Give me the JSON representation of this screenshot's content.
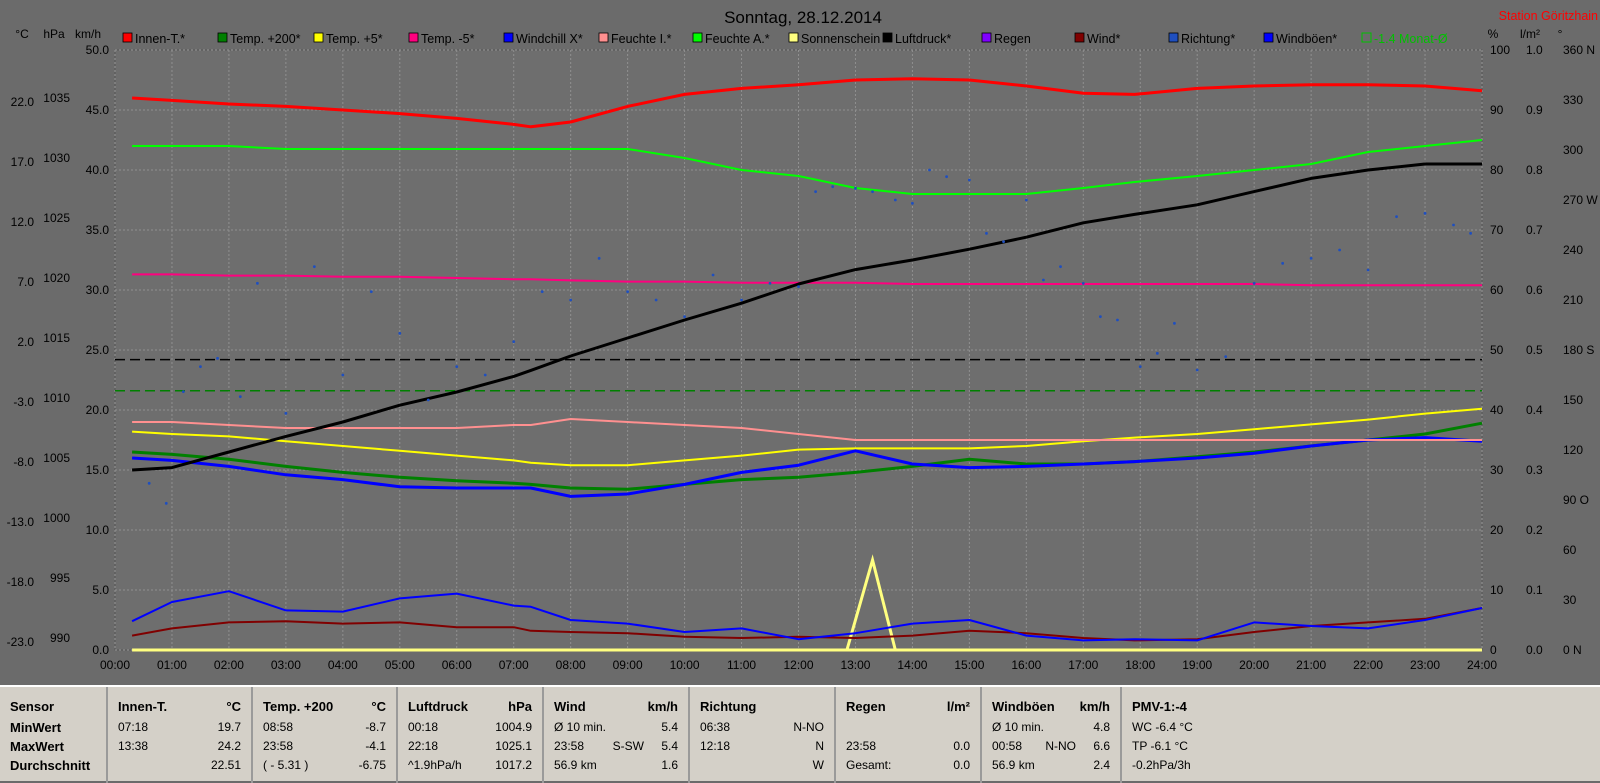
{
  "chart_data": {
    "type": "line",
    "title": "Sonntag, 28.12.2014",
    "station": "Station Göritzhain",
    "axis_units": {
      "left1": "°C",
      "left2": "hPa",
      "left3": "km/h",
      "right1": "%",
      "right2": "l/m²",
      "right3": "°"
    },
    "ylim_temp": [
      -23,
      27
    ],
    "ylim_hpa": [
      990,
      1040
    ],
    "ylim_kmh": [
      0,
      50
    ],
    "ylim_pct": [
      0,
      100
    ],
    "ylim_rain": [
      0,
      1
    ],
    "ylim_dir": [
      0,
      360
    ],
    "ticks_temp": [
      "-23.0",
      "-18.0",
      "-13.0",
      "-8.0",
      "-3.0",
      "2.0",
      "7.0",
      "12.0",
      "17.0",
      "22.0"
    ],
    "ticks_hpa": [
      "990",
      "995",
      "1000",
      "1005",
      "1010",
      "1015",
      "1020",
      "1025",
      "1030",
      "1035"
    ],
    "ticks_kmh": [
      "0.0",
      "5.0",
      "10.0",
      "15.0",
      "20.0",
      "25.0",
      "30.0",
      "35.0",
      "40.0",
      "45.0",
      "50.0"
    ],
    "ticks_pct": [
      "0",
      "10",
      "20",
      "30",
      "40",
      "50",
      "60",
      "70",
      "80",
      "90",
      "100"
    ],
    "ticks_rain": [
      "0.0",
      "0.1",
      "0.2",
      "0.3",
      "0.4",
      "0.5",
      "0.6",
      "0.7",
      "0.8",
      "0.9",
      "1.0"
    ],
    "ticks_dir": [
      "0 N",
      "30",
      "60",
      "90 O",
      "120",
      "150",
      "180 S",
      "210",
      "240",
      "270 W",
      "300",
      "330",
      "360 N"
    ],
    "x_labels": [
      "00:00",
      "01:00",
      "02:00",
      "03:00",
      "04:00",
      "05:00",
      "06:00",
      "07:00",
      "08:00",
      "09:00",
      "10:00",
      "11:00",
      "12:00",
      "13:00",
      "14:00",
      "15:00",
      "16:00",
      "17:00",
      "18:00",
      "19:00",
      "20:00",
      "21:00",
      "22:00",
      "23:00",
      "24:00"
    ],
    "x": [
      0.3,
      1,
      2,
      3,
      4,
      5,
      6,
      7,
      7.3,
      8,
      9,
      10,
      11,
      12,
      13,
      14,
      15,
      16,
      17,
      17.9,
      19,
      20,
      21,
      22,
      23,
      24
    ],
    "legend_note": "-1.4 Monat-Ø",
    "series": [
      {
        "name": "Innen-T.*",
        "color": "#ff0000",
        "axis": "temp",
        "width": 3,
        "values": [
          23.0,
          22.8,
          22.5,
          22.3,
          22.0,
          21.7,
          21.3,
          20.8,
          20.6,
          21.0,
          22.3,
          23.3,
          23.8,
          24.1,
          24.5,
          24.6,
          24.5,
          24.0,
          23.4,
          23.3,
          23.8,
          24.0,
          24.1,
          24.1,
          24.0,
          23.6
        ]
      },
      {
        "name": "Temp. +200*",
        "color": "#008000",
        "axis": "temp",
        "width": 3,
        "values": [
          -6.5,
          -6.7,
          -7.1,
          -7.7,
          -8.2,
          -8.6,
          -8.9,
          -9.1,
          -9.2,
          -9.5,
          -9.6,
          -9.2,
          -8.8,
          -8.6,
          -8.2,
          -7.7,
          -7.1,
          -7.5,
          -7.5,
          -7.3,
          -6.9,
          -6.5,
          -6.0,
          -5.5,
          -5.0,
          -4.1
        ]
      },
      {
        "name": "Temp. +5*",
        "color": "#ffff00",
        "axis": "temp",
        "width": 2,
        "values": [
          -4.8,
          -5.0,
          -5.2,
          -5.6,
          -6.0,
          -6.4,
          -6.8,
          -7.2,
          -7.4,
          -7.6,
          -7.6,
          -7.2,
          -6.8,
          -6.3,
          -6.2,
          -6.2,
          -6.2,
          -6.0,
          -5.6,
          -5.3,
          -5.0,
          -4.6,
          -4.2,
          -3.8,
          -3.3,
          -2.9
        ]
      },
      {
        "name": "Temp. -5*",
        "color": "#ff007f",
        "axis": "temp",
        "width": 2,
        "values": [
          8.3,
          8.3,
          8.2,
          8.2,
          8.1,
          8.1,
          8.0,
          7.9,
          7.9,
          7.8,
          7.7,
          7.7,
          7.6,
          7.6,
          7.6,
          7.5,
          7.5,
          7.5,
          7.5,
          7.5,
          7.5,
          7.5,
          7.4,
          7.4,
          7.4,
          7.4
        ]
      },
      {
        "name": "Windchill X*",
        "color": "#0000ff",
        "axis": "temp",
        "width": 3,
        "values": [
          -7.0,
          -7.2,
          -7.7,
          -8.4,
          -8.8,
          -9.4,
          -9.5,
          -9.5,
          -9.5,
          -10.2,
          -10.0,
          -9.2,
          -8.2,
          -7.6,
          -6.4,
          -7.5,
          -7.8,
          -7.7,
          -7.5,
          -7.3,
          -7.0,
          -6.6,
          -6.0,
          -5.5,
          -5.3,
          -5.6
        ]
      },
      {
        "name": "Feuchte I.*",
        "color": "#ff9090",
        "axis": "pct",
        "width": 2,
        "values": [
          38,
          38,
          37.5,
          37,
          37,
          37,
          37,
          37.5,
          37.5,
          38.5,
          38,
          37.5,
          37,
          36,
          35,
          35,
          35,
          35,
          35,
          35,
          35,
          35,
          35,
          35,
          35,
          35
        ]
      },
      {
        "name": "Feuchte A.*",
        "color": "#00ff00",
        "axis": "pct",
        "width": 2,
        "values": [
          84,
          84,
          84,
          83.5,
          83.5,
          83.5,
          83.5,
          83.5,
          83.5,
          83.5,
          83.5,
          82,
          80,
          79,
          77,
          76,
          76,
          76,
          77,
          78,
          79,
          80,
          81,
          83,
          84,
          85
        ]
      },
      {
        "name": "Sonnenschein",
        "color": "#ffff80",
        "axis": "pct",
        "width": 3,
        "values": [
          0,
          0,
          0,
          0,
          0,
          0,
          0,
          0,
          0,
          0,
          0,
          0,
          0,
          0,
          0,
          0,
          0,
          0,
          0,
          0,
          0,
          0,
          0,
          0,
          0,
          0
        ],
        "spike": {
          "x": [
            12.85,
            13.3,
            13.7
          ],
          "values": [
            0,
            15,
            0
          ]
        }
      },
      {
        "name": "Luftdruck*",
        "color": "#000000",
        "axis": "hpa",
        "width": 3,
        "values": [
          1005.0,
          1005.2,
          1006.5,
          1007.8,
          1009.0,
          1010.4,
          1011.5,
          1012.8,
          1013.3,
          1014.5,
          1016.0,
          1017.5,
          1018.9,
          1020.5,
          1021.7,
          1022.5,
          1023.4,
          1024.4,
          1025.6,
          1026.3,
          1027.1,
          1028.2,
          1029.3,
          1030.0,
          1030.5,
          1030.5
        ]
      },
      {
        "name": "Regen",
        "color": "#8000ff",
        "axis": "rain",
        "width": 2,
        "values": []
      },
      {
        "name": "Wind*",
        "color": "#800000",
        "axis": "kmh",
        "width": 2,
        "values": [
          1.2,
          1.8,
          2.3,
          2.4,
          2.2,
          2.3,
          1.9,
          1.9,
          1.6,
          1.5,
          1.4,
          1.1,
          1.0,
          1.1,
          1.0,
          1.2,
          1.6,
          1.4,
          1.0,
          0.8,
          0.9,
          1.5,
          2.0,
          2.3,
          2.6,
          3.5
        ]
      },
      {
        "name": "Richtung*",
        "color": "#1f4fbf",
        "axis": "dir",
        "width": 0,
        "dots": {
          "x": [
            0.6,
            0.9,
            1.2,
            1.5,
            1.8,
            2.2,
            2.5,
            3.0,
            3.5,
            4.0,
            4.5,
            5.0,
            5.5,
            6.0,
            6.5,
            7.0,
            7.5,
            8.0,
            8.5,
            9.0,
            9.5,
            10.0,
            10.5,
            11.0,
            11.5,
            12.0,
            12.3,
            12.6,
            13.0,
            13.3,
            13.7,
            14.0,
            14.3,
            14.6,
            15.0,
            15.3,
            15.6,
            16.0,
            16.3,
            16.6,
            17.0,
            17.3,
            17.6,
            18.0,
            18.3,
            18.6,
            19.0,
            19.5,
            20.0,
            20.5,
            21.0,
            21.5,
            22.0,
            22.5,
            23.0,
            23.5,
            23.8
          ],
          "values": [
            100,
            88,
            155,
            170,
            175,
            152,
            220,
            142,
            230,
            165,
            215,
            190,
            150,
            170,
            165,
            185,
            215,
            210,
            235,
            215,
            210,
            200,
            225,
            210,
            220,
            218,
            275,
            278,
            277,
            275,
            270,
            268,
            288,
            284,
            282,
            250,
            245,
            270,
            222,
            230,
            220,
            200,
            198,
            170,
            178,
            196,
            168,
            176,
            220,
            232,
            235,
            240,
            228,
            260,
            262,
            255,
            250
          ]
        }
      },
      {
        "name": "Windböen*",
        "color": "#0000ff",
        "axis": "kmh",
        "width": 2,
        "values": [
          2.4,
          4.0,
          4.9,
          3.3,
          3.2,
          4.3,
          4.7,
          3.7,
          3.6,
          2.5,
          2.2,
          1.5,
          1.8,
          0.9,
          1.4,
          2.2,
          2.5,
          1.2,
          0.8,
          0.9,
          0.8,
          2.3,
          2.0,
          1.8,
          2.5,
          3.5
        ]
      }
    ],
    "ref_lines": [
      {
        "axis": "temp",
        "value": 1.2,
        "color": "#000000",
        "dash": "10,5"
      },
      {
        "axis": "temp",
        "value": -1.4,
        "color": "#008000",
        "dash": "10,5"
      }
    ]
  },
  "stats": {
    "columns": [
      {
        "h": "Sensor",
        "u": "",
        "rows": [
          [
            "MinWert",
            "",
            ""
          ],
          [
            "MaxWert",
            "",
            ""
          ],
          [
            "Durchschnitt",
            "",
            ""
          ]
        ]
      },
      {
        "h": "Innen-T.",
        "u": "°C",
        "rows": [
          [
            "07:18",
            "",
            "19.7"
          ],
          [
            "13:38",
            "",
            "24.2"
          ],
          [
            "",
            "",
            "22.51"
          ]
        ]
      },
      {
        "h": "Temp. +200",
        "u": "°C",
        "rows": [
          [
            "08:58",
            "",
            "-8.7"
          ],
          [
            "23:58",
            "",
            "-4.1"
          ],
          [
            "( - 5.31 )",
            "",
            "-6.75"
          ]
        ]
      },
      {
        "h": "Luftdruck",
        "u": "hPa",
        "rows": [
          [
            "00:18",
            "",
            "1004.9"
          ],
          [
            "22:18",
            "",
            "1025.1"
          ],
          [
            "^1.9hPa/h",
            "",
            "1017.2"
          ]
        ]
      },
      {
        "h": "Wind",
        "u": "km/h",
        "rows": [
          [
            "Ø 10 min.",
            "",
            "5.4"
          ],
          [
            "23:58",
            "S-SW",
            "5.4"
          ],
          [
            "56.9 km",
            "",
            "1.6"
          ]
        ]
      },
      {
        "h": "Richtung",
        "u": "",
        "rows": [
          [
            "06:38",
            "N-NO",
            ""
          ],
          [
            "12:18",
            "N",
            ""
          ],
          [
            "",
            "W",
            ""
          ]
        ]
      },
      {
        "h": "Regen",
        "u": "l/m²",
        "rows": [
          [
            "",
            "",
            "",
            ""
          ],
          [
            "23:58",
            "",
            "0.0"
          ],
          [
            "Gesamt:",
            "",
            "0.0"
          ]
        ]
      },
      {
        "h": "Windböen",
        "u": "km/h",
        "rows": [
          [
            "Ø 10 min.",
            "",
            "4.8"
          ],
          [
            "00:58",
            "N-NO",
            "6.6"
          ],
          [
            "56.9 km",
            "",
            "2.4"
          ]
        ]
      },
      {
        "h": "PMV-1:-4",
        "u": "",
        "rows": [
          [
            "WC -6.4 °C",
            "",
            ""
          ],
          [
            "TP -6.1 °C",
            "",
            ""
          ],
          [
            "-0.2hPa/3h",
            "",
            ""
          ]
        ]
      }
    ]
  }
}
